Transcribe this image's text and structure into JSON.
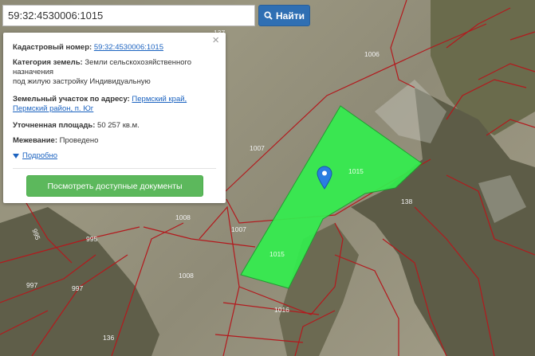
{
  "search": {
    "value": "59:32:4530006:1015",
    "button_label": "Найти"
  },
  "popup": {
    "cadastral_label": "Кадастровый номер:",
    "cadastral_value": "59:32:4530006:1015",
    "category_label": "Категория земель:",
    "category_value_line1": "Земли сельскохозяйственного",
    "category_value_line2": "назначения",
    "category_value_line3": "под жилую застройку Индивидуальную",
    "address_label": "Земельный участок по адресу:",
    "address_value_line1": "Пермский край,",
    "address_value_line2": "Пермский район, п. Юг",
    "area_label": "Уточненная площадь:",
    "area_value": "50 257 кв.м.",
    "survey_label": "Межевание:",
    "survey_value": "Проведено",
    "more_link": "Подробно",
    "docs_button": "Посмотреть доступные документы",
    "close_symbol": "×"
  },
  "map": {
    "parcel_color": "#33ee4e",
    "boundary_color": "#b3191d",
    "marker_color": "#2a7de1",
    "parcel_labels": [
      "1015",
      "1015"
    ],
    "plot_numbers": [
      "1006",
      "1007",
      "1007",
      "1008",
      "1008",
      "1016",
      "995",
      "995",
      "997",
      "997",
      "138",
      "136",
      "137"
    ]
  }
}
